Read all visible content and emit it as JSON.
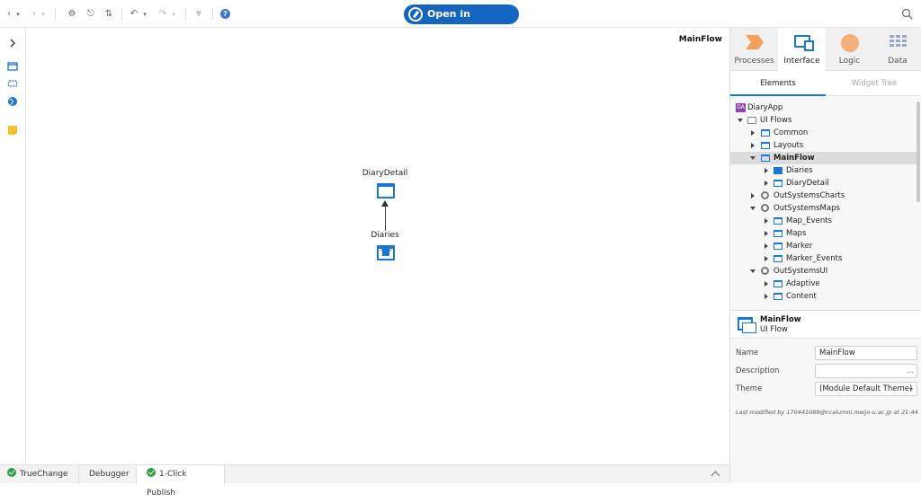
{
  "toolbar": {
    "open_in_browser_label": "Open in browser"
  },
  "canvas": {
    "flow_title": "MainFlow",
    "nodes": {
      "top": {
        "label": "DiaryDetail",
        "icon": "screen-icon"
      },
      "bottom": {
        "label": "Diaries",
        "icon": "home-screen-icon"
      }
    }
  },
  "bottom_tabs": [
    {
      "label": "TrueChange"
    },
    {
      "label": "Debugger"
    },
    {
      "label": "1-Click Publish"
    }
  ],
  "layer_tabs": [
    {
      "label": "Processes"
    },
    {
      "label": "Interface"
    },
    {
      "label": "Logic"
    },
    {
      "label": "Data"
    }
  ],
  "sub_tabs": [
    {
      "label": "Elements"
    },
    {
      "label": "Widget Tree"
    }
  ],
  "tree": [
    {
      "label": "DiaryApp",
      "icon": "app-icon",
      "app_badge": "DA"
    },
    {
      "label": "UI Flows",
      "icon": "folder-icon"
    },
    {
      "label": "Common",
      "icon": "flow-icon"
    },
    {
      "label": "Layouts",
      "icon": "flow-icon"
    },
    {
      "label": "MainFlow",
      "icon": "flow-icon"
    },
    {
      "label": "Diaries",
      "icon": "home-screen-icon"
    },
    {
      "label": "DiaryDetail",
      "icon": "screen-icon"
    },
    {
      "label": "OutSystemsCharts",
      "icon": "module-icon"
    },
    {
      "label": "OutSystemsMaps",
      "icon": "module-icon"
    },
    {
      "label": "Map_Events",
      "icon": "flow-icon"
    },
    {
      "label": "Maps",
      "icon": "flow-icon"
    },
    {
      "label": "Marker",
      "icon": "flow-icon"
    },
    {
      "label": "Marker_Events",
      "icon": "flow-icon"
    },
    {
      "label": "OutSystemsUI",
      "icon": "module-icon"
    },
    {
      "label": "Adaptive",
      "icon": "flow-icon"
    },
    {
      "label": "Content",
      "icon": "flow-icon"
    }
  ],
  "properties": {
    "title": "MainFlow",
    "subtitle": "UI Flow",
    "name_label": "Name",
    "name_value": "MainFlow",
    "description_label": "Description",
    "description_value": "",
    "description_button": "...",
    "theme_label": "Theme",
    "theme_value": "(Module Default Theme)",
    "last_modified": "Last modified by 170441089@ccalumni.meijo-u.ac.jp at 21:44"
  },
  "colors": {
    "accent": "#1565c0",
    "publish_ok": "#2e9e45"
  }
}
